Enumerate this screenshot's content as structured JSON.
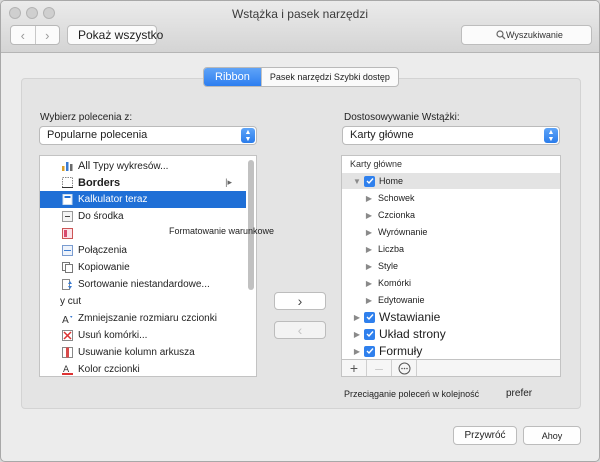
{
  "window": {
    "title": "Wstążka i pasek narzędzi",
    "show_all": "Pokaż wszystko",
    "search_placeholder": "Wyszukiwanie"
  },
  "tabs": [
    {
      "label": "Ribbon",
      "active": true
    },
    {
      "label": "Pasek narzędzi Szybki dostęp",
      "active": false
    }
  ],
  "left": {
    "label": "Wybierz polecenia z:",
    "select_value": "Popularne polecenia",
    "items": [
      {
        "icon": "bar-chart-icon",
        "label_big": "All",
        "label": " Typy wykresów..."
      },
      {
        "icon": "borders-icon",
        "label": "Borders",
        "big": true,
        "submenu": true
      },
      {
        "icon": "calculator-icon",
        "label": "Kalkulator teraz",
        "selected": true
      },
      {
        "icon": "center-align-icon",
        "label": "Do środka"
      },
      {
        "icon": "conditional-format-icon",
        "label": ""
      },
      {
        "icon": "merge-icon",
        "label": "Połączenia"
      },
      {
        "icon": "copy-icon",
        "label": "Kopiowanie"
      },
      {
        "icon": "custom-sort-icon",
        "label": "Sortowanie niestandardowe..."
      },
      {
        "icon": "",
        "label": "y cut"
      },
      {
        "icon": "font-size-decrease-icon",
        "label": "Zmniejszanie rozmiaru czcionki"
      },
      {
        "icon": "delete-cells-icon",
        "label": "Usuń komórki..."
      },
      {
        "icon": "delete-columns-icon",
        "label": "Usuwanie kolumn arkusza"
      },
      {
        "icon": "font-color-icon",
        "label": "Kolor czcionki"
      }
    ],
    "floating_label": "Formatowanie warunkowe"
  },
  "right": {
    "label": "Dostosowywanie Wstążki:",
    "select_value": "Karty główne",
    "tree_header": "Karty główne",
    "tree": [
      {
        "label": "Home",
        "level": 0,
        "expanded": true,
        "checked": true
      },
      {
        "label": "Schowek",
        "level": 1
      },
      {
        "label": "Czcionka",
        "level": 1
      },
      {
        "label": "Wyrównanie",
        "level": 1
      },
      {
        "label": "Liczba",
        "level": 1
      },
      {
        "label": "Style",
        "level": 1
      },
      {
        "label": "Komórki",
        "level": 1
      },
      {
        "label": "Edytowanie",
        "level": 1
      },
      {
        "label": "Wstawianie",
        "level": 0,
        "checked": true
      },
      {
        "label": "Układ strony",
        "level": 0,
        "checked": true
      },
      {
        "label": "Formuły",
        "level": 0,
        "checked": true
      }
    ],
    "hint": "Przeciąganie poleceń w kolejność",
    "hint_extra": "prefer"
  },
  "buttons": {
    "add": "›",
    "remove": "‹",
    "reset": "Przywróć",
    "ok": "Ahoy"
  },
  "colors": {
    "accent": "#2d7ef0",
    "selection": "#1f6fd6"
  }
}
